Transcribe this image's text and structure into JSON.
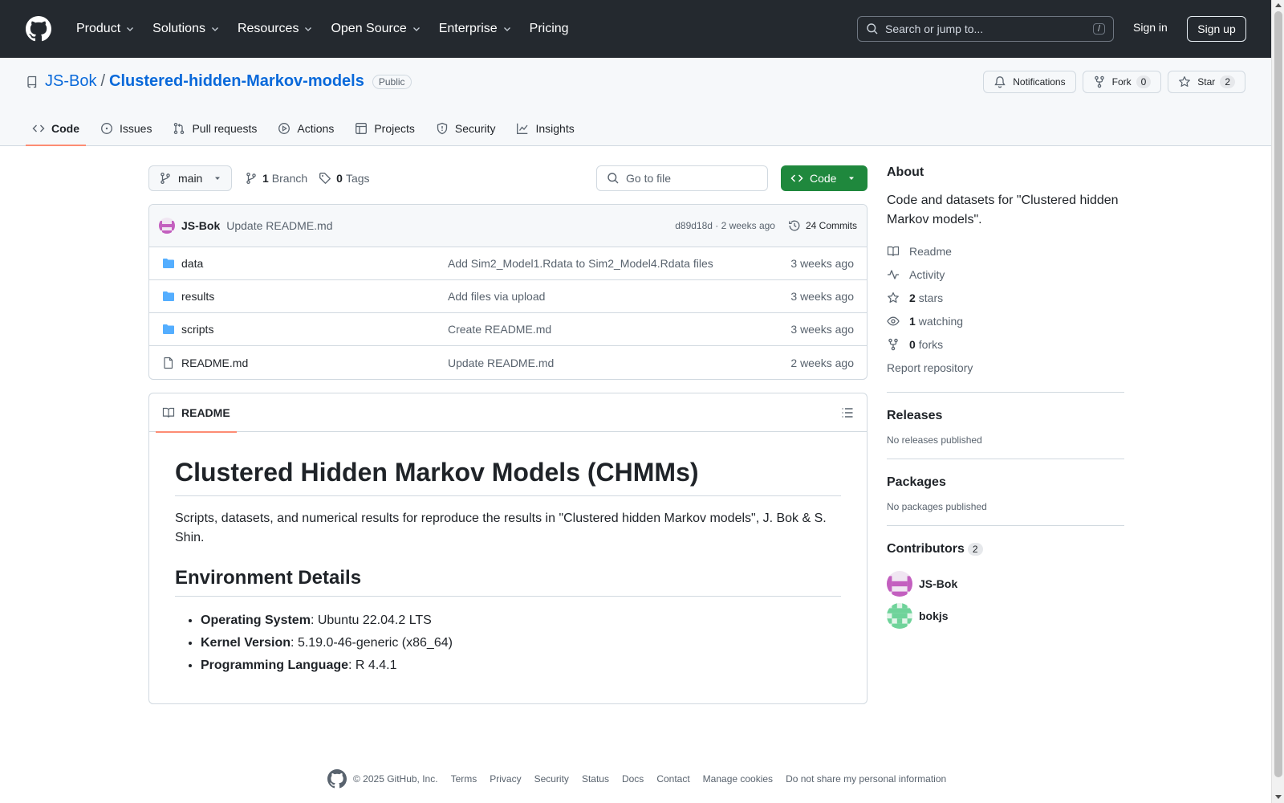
{
  "header": {
    "nav": [
      {
        "label": "Product",
        "dropdown": true
      },
      {
        "label": "Solutions",
        "dropdown": true
      },
      {
        "label": "Resources",
        "dropdown": true
      },
      {
        "label": "Open Source",
        "dropdown": true
      },
      {
        "label": "Enterprise",
        "dropdown": true
      },
      {
        "label": "Pricing",
        "dropdown": false
      }
    ],
    "search_placeholder": "Search or jump to...",
    "search_shortcut": "/",
    "sign_in": "Sign in",
    "sign_up": "Sign up"
  },
  "repo": {
    "owner": "JS-Bok",
    "separator": "/",
    "name": "Clustered-hidden-Markov-models",
    "visibility": "Public",
    "notifications_label": "Notifications",
    "fork_label": "Fork",
    "fork_count": "0",
    "star_label": "Star",
    "star_count": "2"
  },
  "tabs": [
    {
      "label": "Code",
      "icon": "code-icon",
      "active": true
    },
    {
      "label": "Issues",
      "icon": "issue-icon",
      "active": false
    },
    {
      "label": "Pull requests",
      "icon": "pull-request-icon",
      "active": false
    },
    {
      "label": "Actions",
      "icon": "play-icon",
      "active": false
    },
    {
      "label": "Projects",
      "icon": "table-icon",
      "active": false
    },
    {
      "label": "Security",
      "icon": "shield-icon",
      "active": false
    },
    {
      "label": "Insights",
      "icon": "graph-icon",
      "active": false
    }
  ],
  "toolbar": {
    "branch": "main",
    "branch_count": "1",
    "branch_label": "Branch",
    "tag_count": "0",
    "tag_label": "Tags",
    "goto_placeholder": "Go to file",
    "code_button": "Code"
  },
  "commit": {
    "author": "JS-Bok",
    "message": "Update README.md",
    "sha_time": "d89d18d · 2 weeks ago",
    "commits": "24 Commits"
  },
  "files": [
    {
      "name": "data",
      "type": "folder",
      "message": "Add Sim2_Model1.Rdata to Sim2_Model4.Rdata files",
      "date": "3 weeks ago"
    },
    {
      "name": "results",
      "type": "folder",
      "message": "Add files via upload",
      "date": "3 weeks ago"
    },
    {
      "name": "scripts",
      "type": "folder",
      "message": "Create README.md",
      "date": "3 weeks ago"
    },
    {
      "name": "README.md",
      "type": "file",
      "message": "Update README.md",
      "date": "2 weeks ago"
    }
  ],
  "readme": {
    "tab": "README",
    "title": "Clustered Hidden Markov Models (CHMMs)",
    "intro": "Scripts, datasets, and numerical results for reproduce the results in \"Clustered hidden Markov models\", J. Bok & S. Shin.",
    "env_heading": "Environment Details",
    "env": [
      {
        "key": "Operating System",
        "value": ": Ubuntu 22.04.2 LTS"
      },
      {
        "key": "Kernel Version",
        "value": ": 5.19.0-46-generic (x86_64)"
      },
      {
        "key": "Programming Language",
        "value": ": R 4.4.1"
      }
    ]
  },
  "sidebar": {
    "about_heading": "About",
    "about_text": "Code and datasets for \"Clustered hidden Markov models\".",
    "readme_link": "Readme",
    "activity_link": "Activity",
    "stars_count": "2",
    "stars_label": "stars",
    "watching_count": "1",
    "watching_label": "watching",
    "forks_count": "0",
    "forks_label": "forks",
    "report": "Report repository",
    "releases_heading": "Releases",
    "releases_text": "No releases published",
    "packages_heading": "Packages",
    "packages_text": "No packages published",
    "contributors_heading": "Contributors",
    "contributors_count": "2",
    "contributors": [
      {
        "name": "JS-Bok"
      },
      {
        "name": "bokjs"
      }
    ]
  },
  "footer": {
    "copyright": "© 2025 GitHub, Inc.",
    "links": [
      "Terms",
      "Privacy",
      "Security",
      "Status",
      "Docs",
      "Contact",
      "Manage cookies",
      "Do not share my personal information"
    ]
  },
  "colors": {
    "header_bg": "#24292f",
    "link": "#0969da",
    "code_button": "#1f883d",
    "active_tab_underline": "#fd8c73",
    "folder": "#54aeff"
  }
}
